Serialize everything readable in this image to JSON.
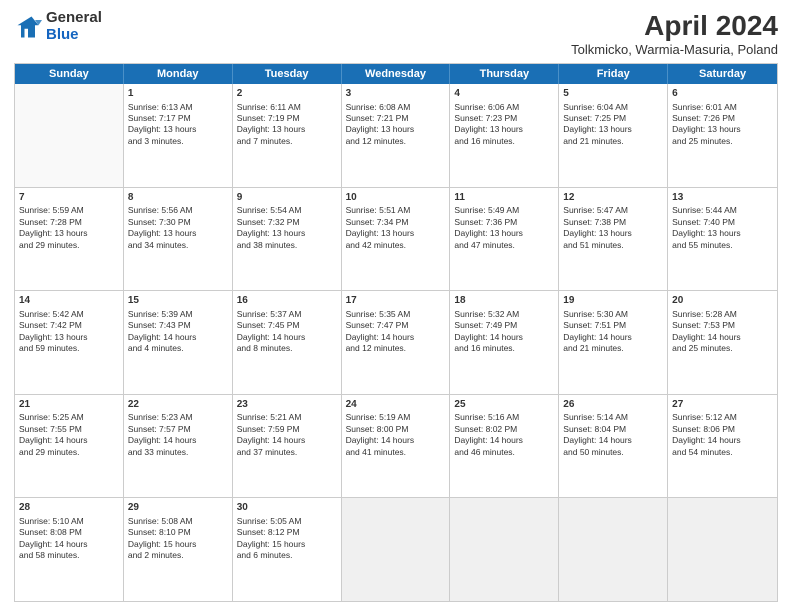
{
  "header": {
    "logo_general": "General",
    "logo_blue": "Blue",
    "month_title": "April 2024",
    "location": "Tolkmicko, Warmia-Masuria, Poland"
  },
  "weekdays": [
    "Sunday",
    "Monday",
    "Tuesday",
    "Wednesday",
    "Thursday",
    "Friday",
    "Saturday"
  ],
  "rows": [
    [
      {
        "day": "",
        "lines": [],
        "empty": true
      },
      {
        "day": "1",
        "lines": [
          "Sunrise: 6:13 AM",
          "Sunset: 7:17 PM",
          "Daylight: 13 hours",
          "and 3 minutes."
        ]
      },
      {
        "day": "2",
        "lines": [
          "Sunrise: 6:11 AM",
          "Sunset: 7:19 PM",
          "Daylight: 13 hours",
          "and 7 minutes."
        ]
      },
      {
        "day": "3",
        "lines": [
          "Sunrise: 6:08 AM",
          "Sunset: 7:21 PM",
          "Daylight: 13 hours",
          "and 12 minutes."
        ]
      },
      {
        "day": "4",
        "lines": [
          "Sunrise: 6:06 AM",
          "Sunset: 7:23 PM",
          "Daylight: 13 hours",
          "and 16 minutes."
        ]
      },
      {
        "day": "5",
        "lines": [
          "Sunrise: 6:04 AM",
          "Sunset: 7:25 PM",
          "Daylight: 13 hours",
          "and 21 minutes."
        ]
      },
      {
        "day": "6",
        "lines": [
          "Sunrise: 6:01 AM",
          "Sunset: 7:26 PM",
          "Daylight: 13 hours",
          "and 25 minutes."
        ]
      }
    ],
    [
      {
        "day": "7",
        "lines": [
          "Sunrise: 5:59 AM",
          "Sunset: 7:28 PM",
          "Daylight: 13 hours",
          "and 29 minutes."
        ]
      },
      {
        "day": "8",
        "lines": [
          "Sunrise: 5:56 AM",
          "Sunset: 7:30 PM",
          "Daylight: 13 hours",
          "and 34 minutes."
        ]
      },
      {
        "day": "9",
        "lines": [
          "Sunrise: 5:54 AM",
          "Sunset: 7:32 PM",
          "Daylight: 13 hours",
          "and 38 minutes."
        ]
      },
      {
        "day": "10",
        "lines": [
          "Sunrise: 5:51 AM",
          "Sunset: 7:34 PM",
          "Daylight: 13 hours",
          "and 42 minutes."
        ]
      },
      {
        "day": "11",
        "lines": [
          "Sunrise: 5:49 AM",
          "Sunset: 7:36 PM",
          "Daylight: 13 hours",
          "and 47 minutes."
        ]
      },
      {
        "day": "12",
        "lines": [
          "Sunrise: 5:47 AM",
          "Sunset: 7:38 PM",
          "Daylight: 13 hours",
          "and 51 minutes."
        ]
      },
      {
        "day": "13",
        "lines": [
          "Sunrise: 5:44 AM",
          "Sunset: 7:40 PM",
          "Daylight: 13 hours",
          "and 55 minutes."
        ]
      }
    ],
    [
      {
        "day": "14",
        "lines": [
          "Sunrise: 5:42 AM",
          "Sunset: 7:42 PM",
          "Daylight: 13 hours",
          "and 59 minutes."
        ]
      },
      {
        "day": "15",
        "lines": [
          "Sunrise: 5:39 AM",
          "Sunset: 7:43 PM",
          "Daylight: 14 hours",
          "and 4 minutes."
        ]
      },
      {
        "day": "16",
        "lines": [
          "Sunrise: 5:37 AM",
          "Sunset: 7:45 PM",
          "Daylight: 14 hours",
          "and 8 minutes."
        ]
      },
      {
        "day": "17",
        "lines": [
          "Sunrise: 5:35 AM",
          "Sunset: 7:47 PM",
          "Daylight: 14 hours",
          "and 12 minutes."
        ]
      },
      {
        "day": "18",
        "lines": [
          "Sunrise: 5:32 AM",
          "Sunset: 7:49 PM",
          "Daylight: 14 hours",
          "and 16 minutes."
        ]
      },
      {
        "day": "19",
        "lines": [
          "Sunrise: 5:30 AM",
          "Sunset: 7:51 PM",
          "Daylight: 14 hours",
          "and 21 minutes."
        ]
      },
      {
        "day": "20",
        "lines": [
          "Sunrise: 5:28 AM",
          "Sunset: 7:53 PM",
          "Daylight: 14 hours",
          "and 25 minutes."
        ]
      }
    ],
    [
      {
        "day": "21",
        "lines": [
          "Sunrise: 5:25 AM",
          "Sunset: 7:55 PM",
          "Daylight: 14 hours",
          "and 29 minutes."
        ]
      },
      {
        "day": "22",
        "lines": [
          "Sunrise: 5:23 AM",
          "Sunset: 7:57 PM",
          "Daylight: 14 hours",
          "and 33 minutes."
        ]
      },
      {
        "day": "23",
        "lines": [
          "Sunrise: 5:21 AM",
          "Sunset: 7:59 PM",
          "Daylight: 14 hours",
          "and 37 minutes."
        ]
      },
      {
        "day": "24",
        "lines": [
          "Sunrise: 5:19 AM",
          "Sunset: 8:00 PM",
          "Daylight: 14 hours",
          "and 41 minutes."
        ]
      },
      {
        "day": "25",
        "lines": [
          "Sunrise: 5:16 AM",
          "Sunset: 8:02 PM",
          "Daylight: 14 hours",
          "and 46 minutes."
        ]
      },
      {
        "day": "26",
        "lines": [
          "Sunrise: 5:14 AM",
          "Sunset: 8:04 PM",
          "Daylight: 14 hours",
          "and 50 minutes."
        ]
      },
      {
        "day": "27",
        "lines": [
          "Sunrise: 5:12 AM",
          "Sunset: 8:06 PM",
          "Daylight: 14 hours",
          "and 54 minutes."
        ]
      }
    ],
    [
      {
        "day": "28",
        "lines": [
          "Sunrise: 5:10 AM",
          "Sunset: 8:08 PM",
          "Daylight: 14 hours",
          "and 58 minutes."
        ]
      },
      {
        "day": "29",
        "lines": [
          "Sunrise: 5:08 AM",
          "Sunset: 8:10 PM",
          "Daylight: 15 hours",
          "and 2 minutes."
        ]
      },
      {
        "day": "30",
        "lines": [
          "Sunrise: 5:05 AM",
          "Sunset: 8:12 PM",
          "Daylight: 15 hours",
          "and 6 minutes."
        ]
      },
      {
        "day": "",
        "lines": [],
        "empty": true,
        "shaded": true
      },
      {
        "day": "",
        "lines": [],
        "empty": true,
        "shaded": true
      },
      {
        "day": "",
        "lines": [],
        "empty": true,
        "shaded": true
      },
      {
        "day": "",
        "lines": [],
        "empty": true,
        "shaded": true
      }
    ]
  ]
}
